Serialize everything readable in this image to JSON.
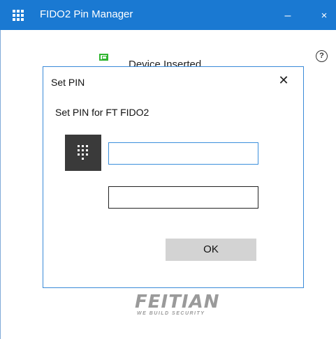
{
  "titlebar": {
    "title": "FIDO2 Pin Manager",
    "minimize_label": "–",
    "close_label": "×",
    "accent_color": "#1a79d2"
  },
  "main": {
    "device_status": "Device Inserted",
    "device_status_icon": "usb-key-icon",
    "help_icon_label": "?"
  },
  "dialog": {
    "title": "Set PIN",
    "close_label": "✕",
    "message": "Set PIN for FT FIDO2",
    "pin_field_value": "",
    "confirm_field_value": "",
    "ok_label": "OK"
  },
  "footer": {
    "logo_text": "FEITIAN",
    "logo_tagline": "WE BUILD SECURITY"
  }
}
